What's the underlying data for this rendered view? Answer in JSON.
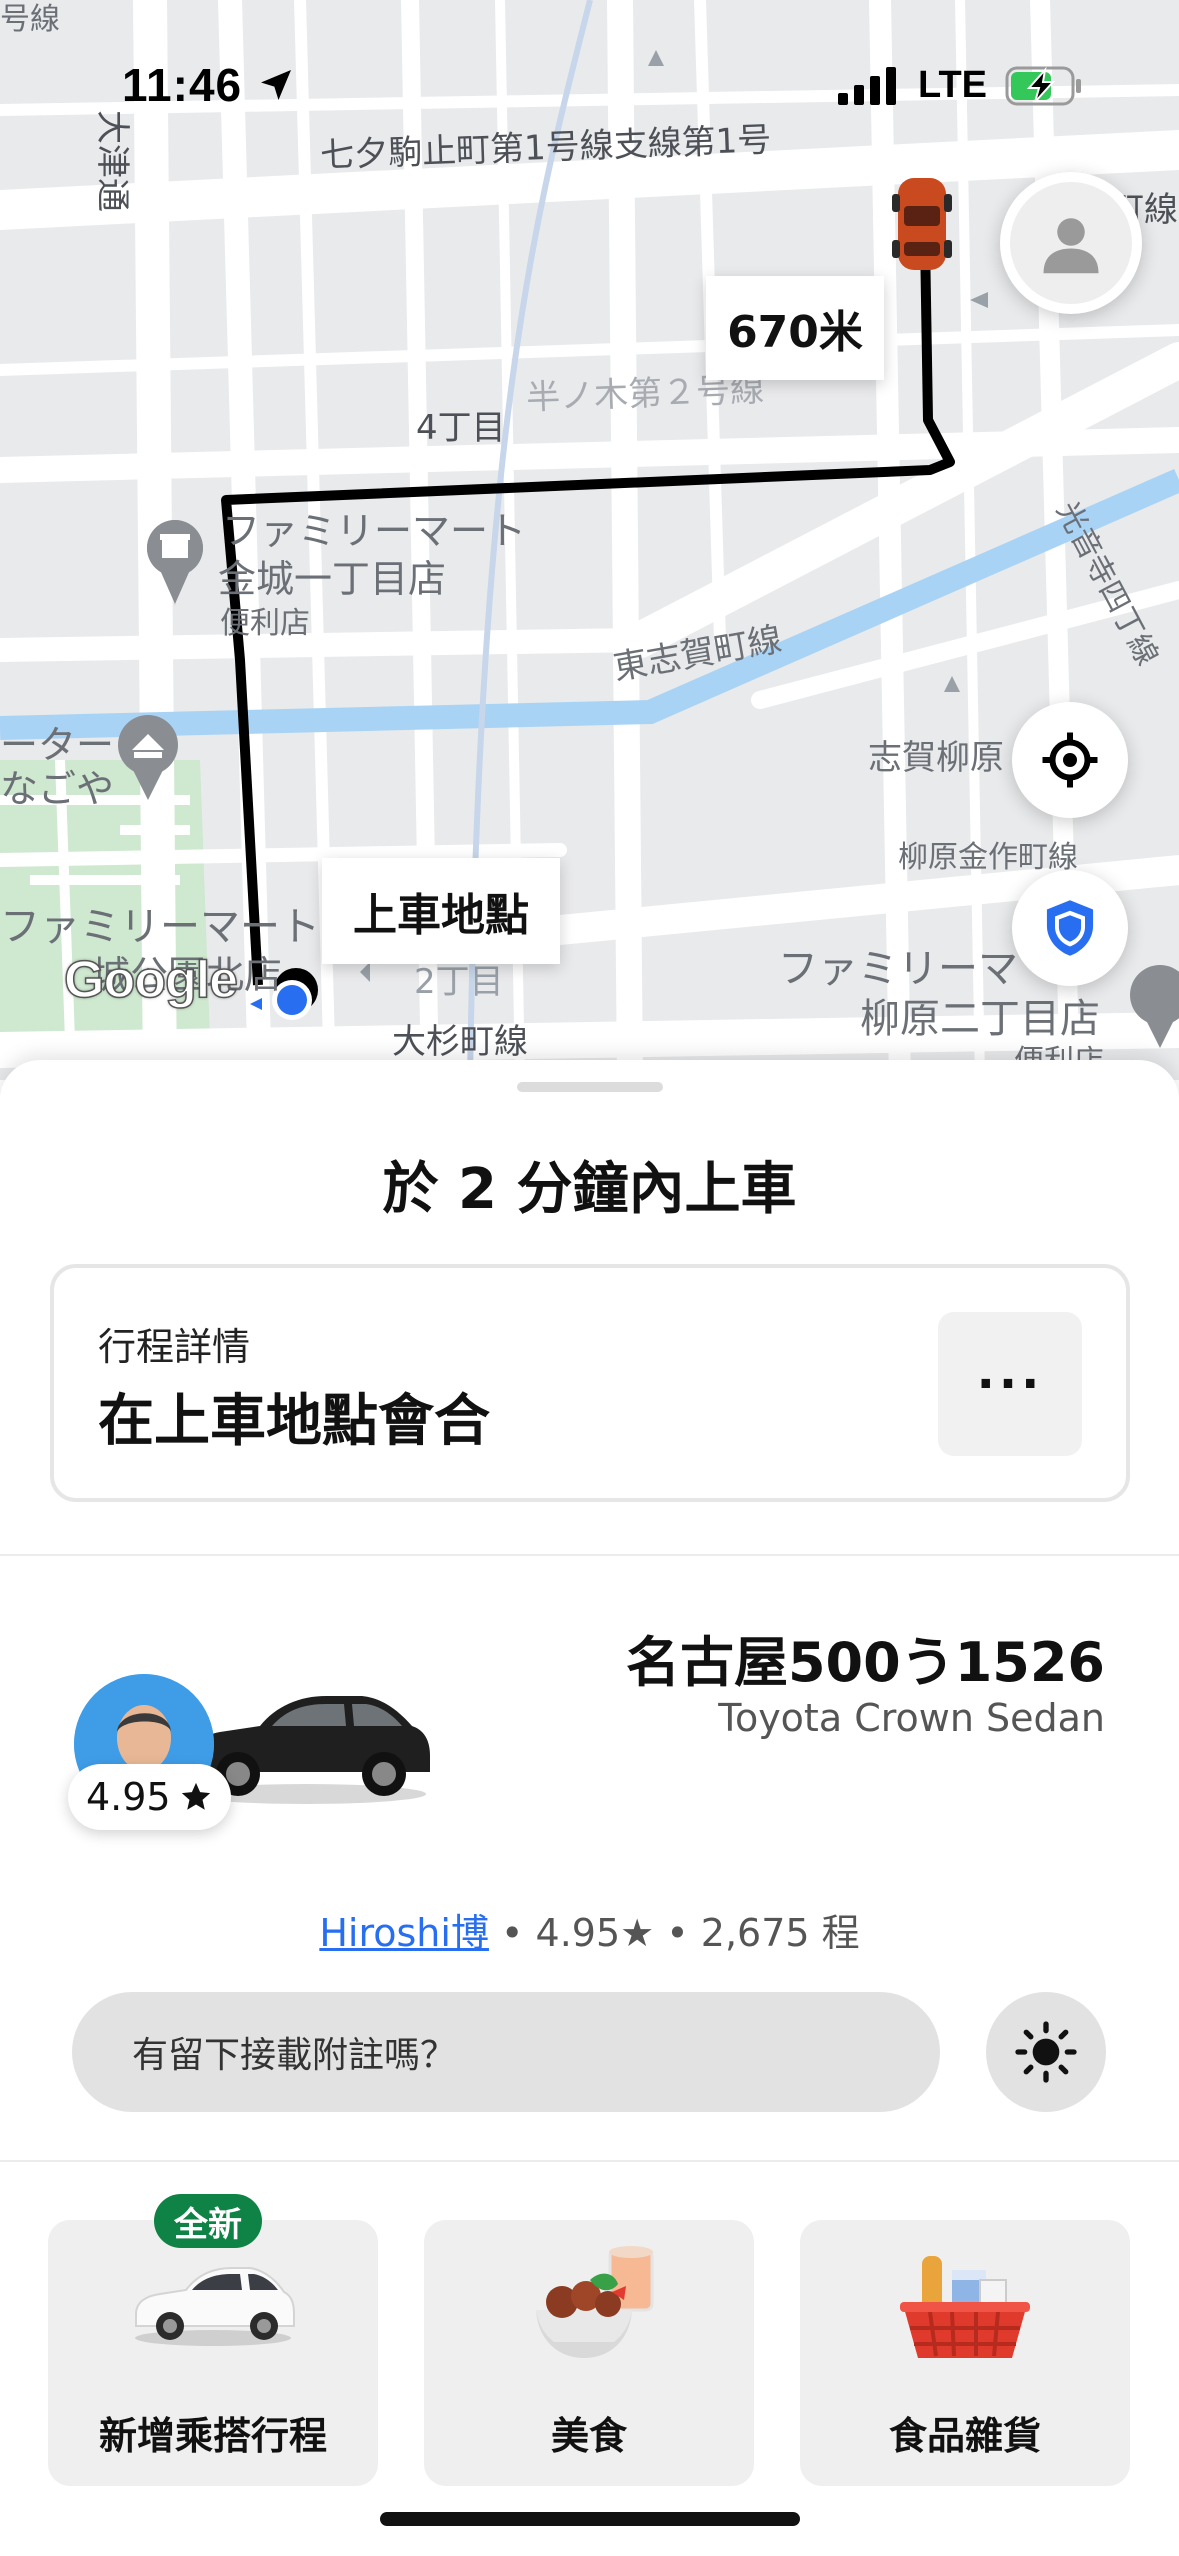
{
  "status_bar": {
    "time": "11:46",
    "network": "LTE"
  },
  "map": {
    "labels": {
      "street_north": "七夕駒止町第1号線支線第1号",
      "district_4": "4丁目",
      "street_han": "半ノ木第２号線",
      "store1_name": "ファミリーマート",
      "store1_branch": "金城一丁目店",
      "store1_type": "便利店",
      "street_east": "東志賀町線",
      "street_east_top": "光音寺四丁線",
      "area_shiga": "志賀柳原",
      "street_yanagi": "柳原金作町線",
      "store2_name": "ファミリーマ",
      "store2_branch": "柳原二丁目店",
      "store2_type": "便利店",
      "place_left": "ーター",
      "place_left2": "なごや",
      "store3_name": "ファミリーマート",
      "store3_branch": "城公園北店",
      "district_2": "2丁目",
      "street_osugi": "大杉町線",
      "street_west": "大津通",
      "top_right_fragment": "町線",
      "top_left_fragment": "号線"
    },
    "distance_chip": "670米",
    "pickup_chip": "上車地點",
    "google_logo": "Google",
    "icons": {
      "profile": "person-icon",
      "locate": "crosshair-icon",
      "safety": "shield-icon"
    },
    "route_color": "#000000",
    "rider_dot_color": "#276ef1",
    "car_color": "#c84a1e"
  },
  "sheet": {
    "eta_title": "於 2 分鐘內上車",
    "trip_card": {
      "label": "行程詳情",
      "value": "在上車地點會合",
      "more": "···"
    },
    "vehicle": {
      "plate": "名古屋500う1526",
      "model": "Toyota Crown Sedan"
    },
    "driver": {
      "rating": "4.95",
      "name": "Hiroshi博",
      "stats": " • 4.95★ • 2,675 程"
    },
    "note_placeholder": "有留下接載附註嗎？",
    "tiles": [
      {
        "label": "新增乘搭行程",
        "badge": "全新"
      },
      {
        "label": "美食"
      },
      {
        "label": "食品雜貨"
      }
    ]
  },
  "colors": {
    "accent_blue": "#276ef1",
    "badge_green": "#0e8345",
    "battery_green": "#34c759"
  }
}
